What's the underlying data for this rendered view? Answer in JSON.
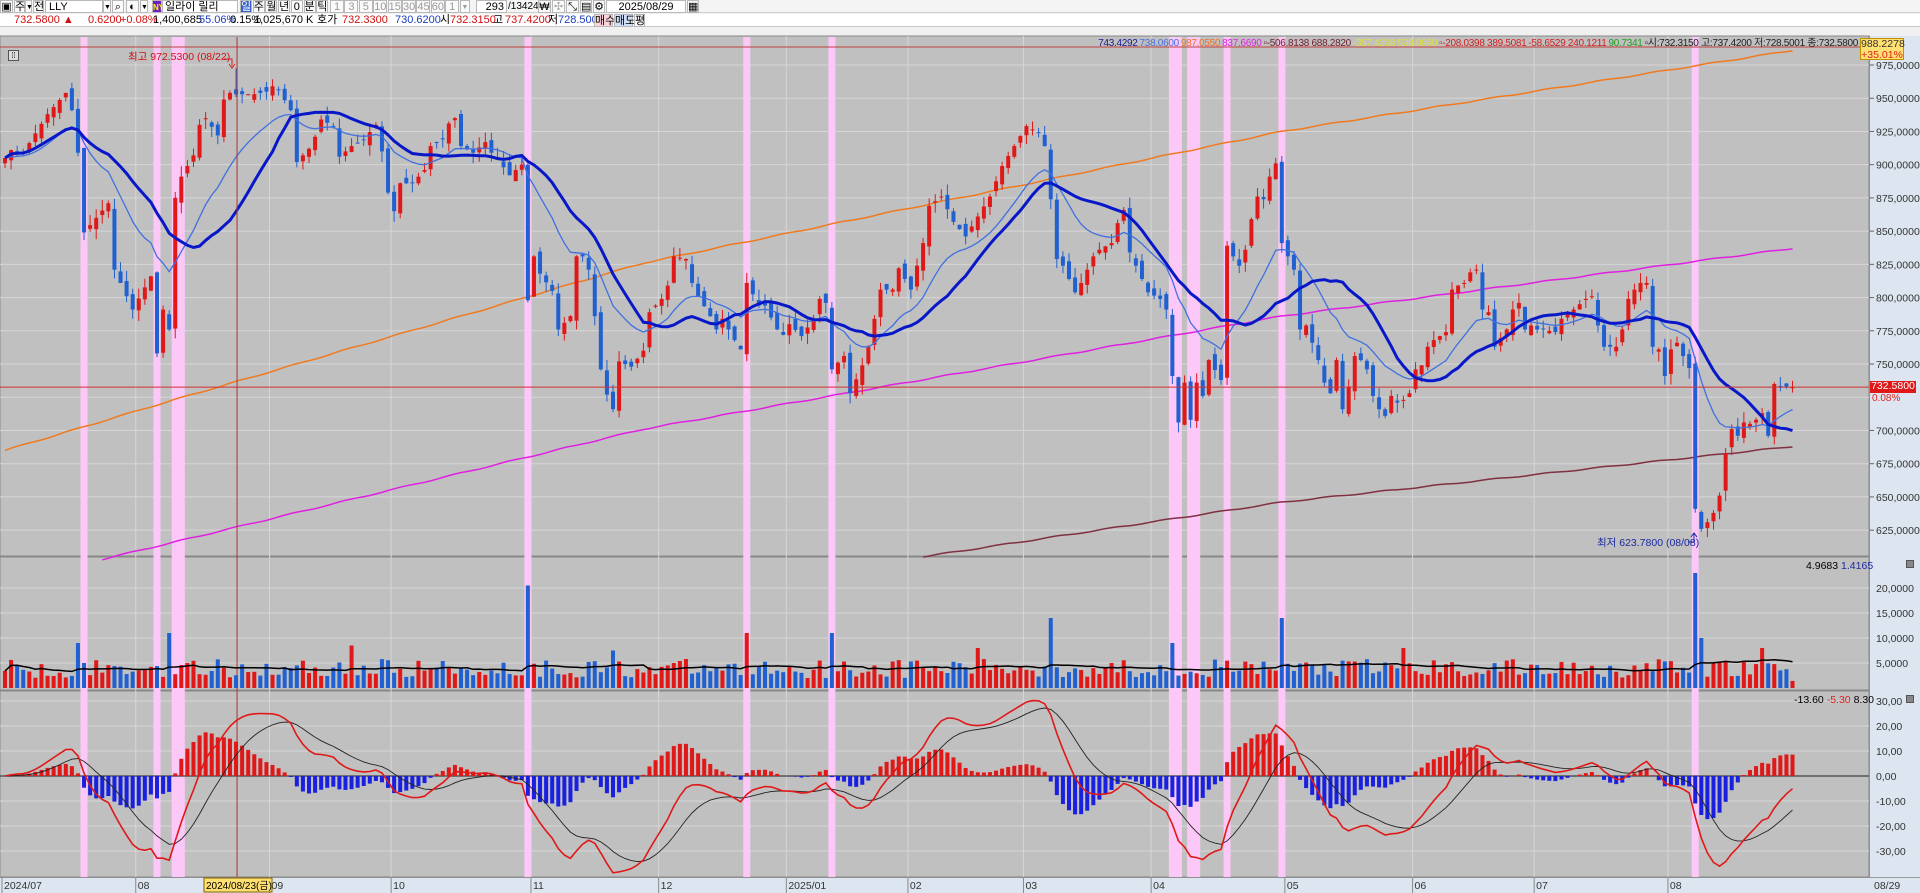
{
  "toolbar": {
    "period_type": "주",
    "all_label": "전",
    "symbol": "LLY",
    "exchange_badge": "NY",
    "stock_name": "일라이 릴리",
    "period_tabs": [
      "일",
      "주",
      "월",
      "년",
      "0",
      "분",
      "틱"
    ],
    "selected_tab": "일",
    "intervals": [
      "1",
      "3",
      "5",
      "10",
      "15",
      "30",
      "45",
      "60",
      "1"
    ],
    "count_value": "293",
    "count_total": "/13424",
    "date_value": "2025/08/29",
    "icons": [
      "layout-icon",
      "search-icon",
      "speaker-icon",
      "won-icon",
      "crosshair-icon",
      "draw-icon",
      "save-icon",
      "gear-icon",
      "calendar-icon"
    ]
  },
  "quote": {
    "price": "732.5800 ▲",
    "change": "0.6200",
    "change_pct": "+0.08%",
    "volume": "1,400,685",
    "vol_ratio": "55.06%",
    "turnover": "0.15%",
    "amount": "1,025,670 K",
    "bid_ask_label": "호가",
    "ask": "732.3300",
    "bid": "730.6200",
    "open_label": "시",
    "open": "732.3150",
    "high_label": "고",
    "high": "737.4200",
    "low_label": "저",
    "low": "728.5001",
    "buy_label": "매수",
    "sell_label": "매도",
    "avg_label": "평"
  },
  "legend": [
    {
      "text": "743.4292",
      "color": "#1a1a90"
    },
    {
      "text": "738.0600",
      "color": "#4a70e0"
    },
    {
      "text": "987.0550",
      "color": "#f07020"
    },
    {
      "text": "837.6690",
      "color": "#e020e0"
    },
    {
      "text": "▫-506.8138 688.2820",
      "color": "#702030"
    },
    {
      "text": "-357.4268 538.0860",
      "color": "#e0e040"
    },
    {
      "text": "▫-208.0398 389.5081",
      "color": "#d02020"
    },
    {
      "text": "-58.6529 240.1211",
      "color": "#d02020"
    },
    {
      "text": "90.7341",
      "color": "#20a020"
    },
    {
      "text": "▫시:732.3150 고:737.4200 저:728.5001 종:732.5800",
      "color": "#202020"
    }
  ],
  "markers": {
    "top_value": "988.2278",
    "top_pct": "+35.01%",
    "current_price": "732.5800",
    "current_pct": "0.08%",
    "high_note": "최고 972.5300 (08/22)",
    "low_note": "최저 623.7800 (08/08)"
  },
  "volume_header": {
    "ma": "4.9683",
    "value": "1.4165"
  },
  "macd_header": {
    "signal": "-13.60",
    "macd": "-5.30",
    "osc": "8.30"
  },
  "colors": {
    "up": "#e01818",
    "down": "#2060d0",
    "ma_thick": "#0818c8",
    "ma_thin": "#4070e0",
    "ma_orange": "#f07a20",
    "ma_magenta": "#e020e0",
    "ma_maroon": "#803040",
    "bg": "#c0c0c0",
    "highlight": "#fbc8f8"
  },
  "chart_data": {
    "type": "candlestick",
    "days": 295,
    "close_anchors": [
      [
        0,
        905
      ],
      [
        1,
        911
      ],
      [
        3,
        909
      ],
      [
        7,
        938
      ],
      [
        10,
        954
      ],
      [
        11,
        941
      ],
      [
        12,
        909
      ],
      [
        13,
        849
      ],
      [
        17,
        871
      ],
      [
        18,
        821
      ],
      [
        21,
        791
      ],
      [
        24,
        816
      ],
      [
        25,
        758
      ],
      [
        26,
        791
      ],
      [
        27,
        776
      ],
      [
        28,
        875
      ],
      [
        29,
        891
      ],
      [
        31,
        907
      ],
      [
        32,
        930
      ],
      [
        33,
        935
      ],
      [
        35,
        922
      ],
      [
        36,
        949
      ],
      [
        37,
        954
      ],
      [
        38,
        953
      ],
      [
        41,
        953
      ],
      [
        43,
        955
      ],
      [
        44,
        959
      ],
      [
        45,
        956
      ],
      [
        47,
        941
      ],
      [
        48,
        902
      ],
      [
        50,
        912
      ],
      [
        51,
        921
      ],
      [
        52,
        934
      ],
      [
        54,
        929
      ],
      [
        55,
        906
      ],
      [
        57,
        914
      ],
      [
        59,
        919
      ],
      [
        61,
        930
      ],
      [
        62,
        910
      ],
      [
        63,
        879
      ],
      [
        64,
        865
      ],
      [
        65,
        886
      ],
      [
        67,
        886
      ],
      [
        69,
        896
      ],
      [
        70,
        914
      ],
      [
        72,
        919
      ],
      [
        73,
        931
      ],
      [
        74,
        935
      ],
      [
        75,
        914
      ],
      [
        77,
        909
      ],
      [
        79,
        917
      ],
      [
        80,
        909
      ],
      [
        81,
        904
      ],
      [
        83,
        892
      ],
      [
        84,
        896
      ],
      [
        85,
        900
      ],
      [
        86,
        798
      ],
      [
        87,
        831
      ],
      [
        88,
        818
      ],
      [
        90,
        805
      ],
      [
        91,
        776
      ],
      [
        93,
        786
      ],
      [
        94,
        831
      ],
      [
        95,
        831
      ],
      [
        96,
        821
      ],
      [
        97,
        786
      ],
      [
        98,
        746
      ],
      [
        99,
        727
      ],
      [
        100,
        716
      ],
      [
        101,
        752
      ],
      [
        103,
        748
      ],
      [
        104,
        754
      ],
      [
        105,
        760
      ],
      [
        106,
        789
      ],
      [
        108,
        799
      ],
      [
        109,
        809
      ],
      [
        110,
        831
      ],
      [
        112,
        829
      ],
      [
        113,
        811
      ],
      [
        114,
        801
      ],
      [
        116,
        786
      ],
      [
        117,
        776
      ],
      [
        118,
        784
      ],
      [
        120,
        768
      ],
      [
        121,
        761
      ],
      [
        122,
        811
      ],
      [
        124,
        794
      ],
      [
        125,
        794
      ],
      [
        127,
        776
      ],
      [
        128,
        772
      ],
      [
        129,
        780
      ],
      [
        131,
        771
      ],
      [
        133,
        784
      ],
      [
        134,
        799
      ],
      [
        135,
        796
      ],
      [
        136,
        746
      ],
      [
        138,
        756
      ],
      [
        139,
        728
      ],
      [
        141,
        749
      ],
      [
        142,
        763
      ],
      [
        143,
        784
      ],
      [
        144,
        806
      ],
      [
        146,
        806
      ],
      [
        147,
        822
      ],
      [
        149,
        806
      ],
      [
        150,
        824
      ],
      [
        151,
        841
      ],
      [
        152,
        869
      ],
      [
        154,
        876
      ],
      [
        156,
        857
      ],
      [
        158,
        846
      ],
      [
        160,
        861
      ],
      [
        162,
        876
      ],
      [
        164,
        899
      ],
      [
        166,
        914
      ],
      [
        168,
        929
      ],
      [
        170,
        924
      ],
      [
        171,
        914
      ],
      [
        172,
        874
      ],
      [
        173,
        829
      ],
      [
        174,
        824
      ],
      [
        176,
        804
      ],
      [
        177,
        811
      ],
      [
        179,
        831
      ],
      [
        180,
        836
      ],
      [
        182,
        841
      ],
      [
        183,
        856
      ],
      [
        184,
        866
      ],
      [
        185,
        834
      ],
      [
        186,
        824
      ],
      [
        188,
        804
      ],
      [
        190,
        799
      ],
      [
        191,
        791
      ],
      [
        192,
        741
      ],
      [
        193,
        706
      ],
      [
        194,
        736
      ],
      [
        195,
        708
      ],
      [
        196,
        736
      ],
      [
        197,
        726
      ],
      [
        198,
        753
      ],
      [
        200,
        738
      ],
      [
        201,
        839
      ],
      [
        202,
        831
      ],
      [
        203,
        824
      ],
      [
        204,
        836
      ],
      [
        205,
        859
      ],
      [
        206,
        876
      ],
      [
        207,
        874
      ],
      [
        208,
        891
      ],
      [
        209,
        901
      ],
      [
        210,
        841
      ],
      [
        212,
        821
      ],
      [
        213,
        776
      ],
      [
        214,
        779
      ],
      [
        216,
        753
      ],
      [
        217,
        736
      ],
      [
        218,
        728
      ],
      [
        219,
        753
      ],
      [
        220,
        716
      ],
      [
        221,
        733
      ],
      [
        222,
        756
      ],
      [
        223,
        753
      ],
      [
        224,
        746
      ],
      [
        225,
        726
      ],
      [
        226,
        716
      ],
      [
        227,
        711
      ],
      [
        228,
        726
      ],
      [
        229,
        721
      ],
      [
        230,
        723
      ],
      [
        231,
        728
      ],
      [
        232,
        746
      ],
      [
        233,
        749
      ],
      [
        234,
        763
      ],
      [
        235,
        768
      ],
      [
        236,
        771
      ],
      [
        237,
        774
      ],
      [
        238,
        806
      ],
      [
        239,
        809
      ],
      [
        240,
        811
      ],
      [
        241,
        819
      ],
      [
        242,
        821
      ],
      [
        243,
        791
      ],
      [
        244,
        789
      ],
      [
        245,
        763
      ],
      [
        247,
        776
      ],
      [
        248,
        791
      ],
      [
        249,
        796
      ],
      [
        250,
        776
      ],
      [
        251,
        779
      ],
      [
        252,
        776
      ],
      [
        253,
        776
      ],
      [
        255,
        774
      ],
      [
        256,
        784
      ],
      [
        258,
        791
      ],
      [
        260,
        799
      ],
      [
        261,
        801
      ],
      [
        262,
        779
      ],
      [
        263,
        763
      ],
      [
        265,
        763
      ],
      [
        266,
        776
      ],
      [
        267,
        799
      ],
      [
        268,
        806
      ],
      [
        269,
        811
      ],
      [
        270,
        811
      ],
      [
        271,
        763
      ],
      [
        272,
        761
      ],
      [
        273,
        741
      ],
      [
        274,
        761
      ],
      [
        275,
        766
      ],
      [
        276,
        756
      ],
      [
        277,
        747
      ],
      [
        278,
        641
      ],
      [
        279,
        626
      ],
      [
        280,
        631
      ],
      [
        281,
        638
      ],
      [
        282,
        651
      ],
      [
        283,
        683
      ],
      [
        284,
        701
      ],
      [
        285,
        696
      ],
      [
        286,
        706
      ],
      [
        287,
        705
      ],
      [
        288,
        708
      ],
      [
        289,
        713
      ],
      [
        290,
        696
      ],
      [
        291,
        735
      ],
      [
        292,
        733
      ],
      [
        293,
        733
      ],
      [
        294,
        732.58
      ]
    ],
    "last_candle": {
      "open": 732.315,
      "high": 737.42,
      "low": 728.5001,
      "close": 732.58
    },
    "period_high": {
      "day": 38,
      "value": 972.53
    },
    "period_low": {
      "day": 279,
      "value": 623.78
    },
    "long_ma": {
      "orange": [
        [
          0,
          685
        ],
        [
          27,
          722
        ],
        [
          105,
          826
        ],
        [
          210,
          925
        ],
        [
          294,
          986
        ]
      ],
      "magenta": [
        [
          16,
          603
        ],
        [
          105,
          701
        ],
        [
          210,
          786
        ],
        [
          294,
          837
        ]
      ],
      "maroon": [
        [
          151,
          605
        ],
        [
          210,
          646
        ],
        [
          294,
          688
        ]
      ]
    },
    "volume_spikes": [
      [
        12,
        9
      ],
      [
        27,
        11
      ],
      [
        57,
        8.5
      ],
      [
        86,
        20.5
      ],
      [
        100,
        7.5
      ],
      [
        122,
        11
      ],
      [
        136,
        11
      ],
      [
        160,
        8
      ],
      [
        172,
        14
      ],
      [
        192,
        9
      ],
      [
        210,
        14
      ],
      [
        230,
        8
      ],
      [
        278,
        23
      ],
      [
        279,
        10
      ],
      [
        289,
        8
      ],
      [
        294,
        1.4165
      ]
    ],
    "highlight_days": [
      [
        13,
        13
      ],
      [
        25,
        25
      ],
      [
        28,
        29
      ],
      [
        86,
        86
      ],
      [
        122,
        122
      ],
      [
        136,
        136
      ],
      [
        192,
        193
      ],
      [
        195,
        196
      ],
      [
        201,
        201
      ],
      [
        210,
        210
      ],
      [
        278,
        278
      ]
    ],
    "crosshair_day": 38,
    "price_ticks": [
      "975,0000",
      "950,0000",
      "925,0000",
      "900,0000",
      "875,0000",
      "850,0000",
      "825,0000",
      "800,0000",
      "775,0000",
      "750,0000",
      "700,0000",
      "675,0000",
      "650,0000",
      "625,0000"
    ],
    "volume_ticks": [
      "20,0000",
      "15,0000",
      "10,0000",
      "5,0000"
    ],
    "macd_ticks": [
      "30,00",
      "20,00",
      "10,00",
      "0,00",
      "-10,00",
      "-20,00",
      "-30,00"
    ],
    "date_labels": [
      {
        "day": 0,
        "text": "2024/07"
      },
      {
        "day": 22,
        "text": "08"
      },
      {
        "day": 44,
        "text": "09"
      },
      {
        "day": 64,
        "text": "10"
      },
      {
        "day": 87,
        "text": "11"
      },
      {
        "day": 108,
        "text": "12"
      },
      {
        "day": 129,
        "text": "2025/01"
      },
      {
        "day": 149,
        "text": "02"
      },
      {
        "day": 168,
        "text": "03"
      },
      {
        "day": 189,
        "text": "04"
      },
      {
        "day": 211,
        "text": "05"
      },
      {
        "day": 232,
        "text": "06"
      },
      {
        "day": 252,
        "text": "07"
      },
      {
        "day": 274,
        "text": "08"
      }
    ],
    "end_date_label": "08/29",
    "crosshair_label": "2024/08/23(금)"
  }
}
